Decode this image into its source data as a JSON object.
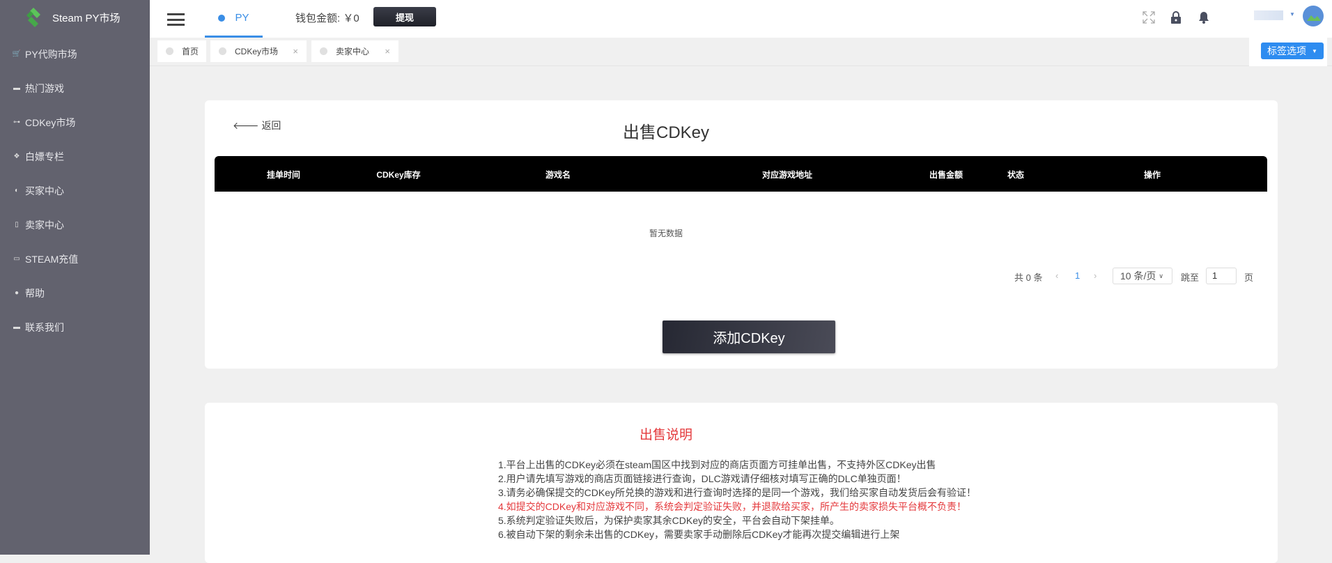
{
  "sidebar": {
    "brand": "Steam PY市场",
    "items": [
      {
        "label": "PY代购市场",
        "icon": "cart-icon"
      },
      {
        "label": "热门游戏",
        "icon": "tv-icon"
      },
      {
        "label": "CDKey市场",
        "icon": "key-icon"
      },
      {
        "label": "白嫖专栏",
        "icon": "gift-icon"
      },
      {
        "label": "买家中心",
        "icon": "user-circle-icon"
      },
      {
        "label": "卖家中心",
        "icon": "clipboard-icon"
      },
      {
        "label": "STEAM充值",
        "icon": "money-icon"
      },
      {
        "label": "帮助",
        "icon": "help-icon"
      },
      {
        "label": "联系我们",
        "icon": "chat-icon"
      }
    ]
  },
  "header": {
    "py_tab": "PY",
    "wallet": "钱包金额: ￥0",
    "withdraw": "提现"
  },
  "tabs": [
    {
      "label": "首页"
    },
    {
      "label": "CDKey市场",
      "close": "×"
    },
    {
      "label": "卖家中心",
      "close": "×"
    }
  ],
  "tag_options": "标签选项",
  "main": {
    "back": "返回",
    "title": "出售CDKey",
    "columns": [
      "挂单时间",
      "CDKey库存",
      "游戏名",
      "对应游戏地址",
      "出售金额",
      "状态",
      "操作"
    ],
    "empty": "暂无数据",
    "pagination": {
      "total": "共 0 条",
      "page": "1",
      "page_size": "10 条/页",
      "goto": "跳至",
      "goto_value": "1",
      "page_unit": "页"
    },
    "add_button": "添加CDKey"
  },
  "instructions": {
    "title": "出售说明",
    "lines": [
      "1.平台上出售的CDKey必须在steam国区中找到对应的商店页面方可挂单出售，不支持外区CDKey出售",
      "2.用户请先填写游戏的商店页面链接进行查询，DLC游戏请仔细核对填写正确的DLC单独页面！",
      "3.请务必确保提交的CDKey所兑换的游戏和进行查询时选择的是同一个游戏，我们给买家自动发货后会有验证！",
      "4.如提交的CDKey和对应游戏不同，系统会判定验证失败，并退款给买家，所产生的卖家损失平台概不负责！",
      "5.系统判定验证失败后，为保护卖家其余CDKey的安全，平台会自动下架挂单。",
      "6.被自动下架的剩余未出售的CDKey，需要卖家手动删除后CDKey才能再次提交编辑进行上架"
    ]
  },
  "colors": {
    "sidebar": "#62626e",
    "accent": "#2d8cf0",
    "warning": "#e4393c"
  }
}
